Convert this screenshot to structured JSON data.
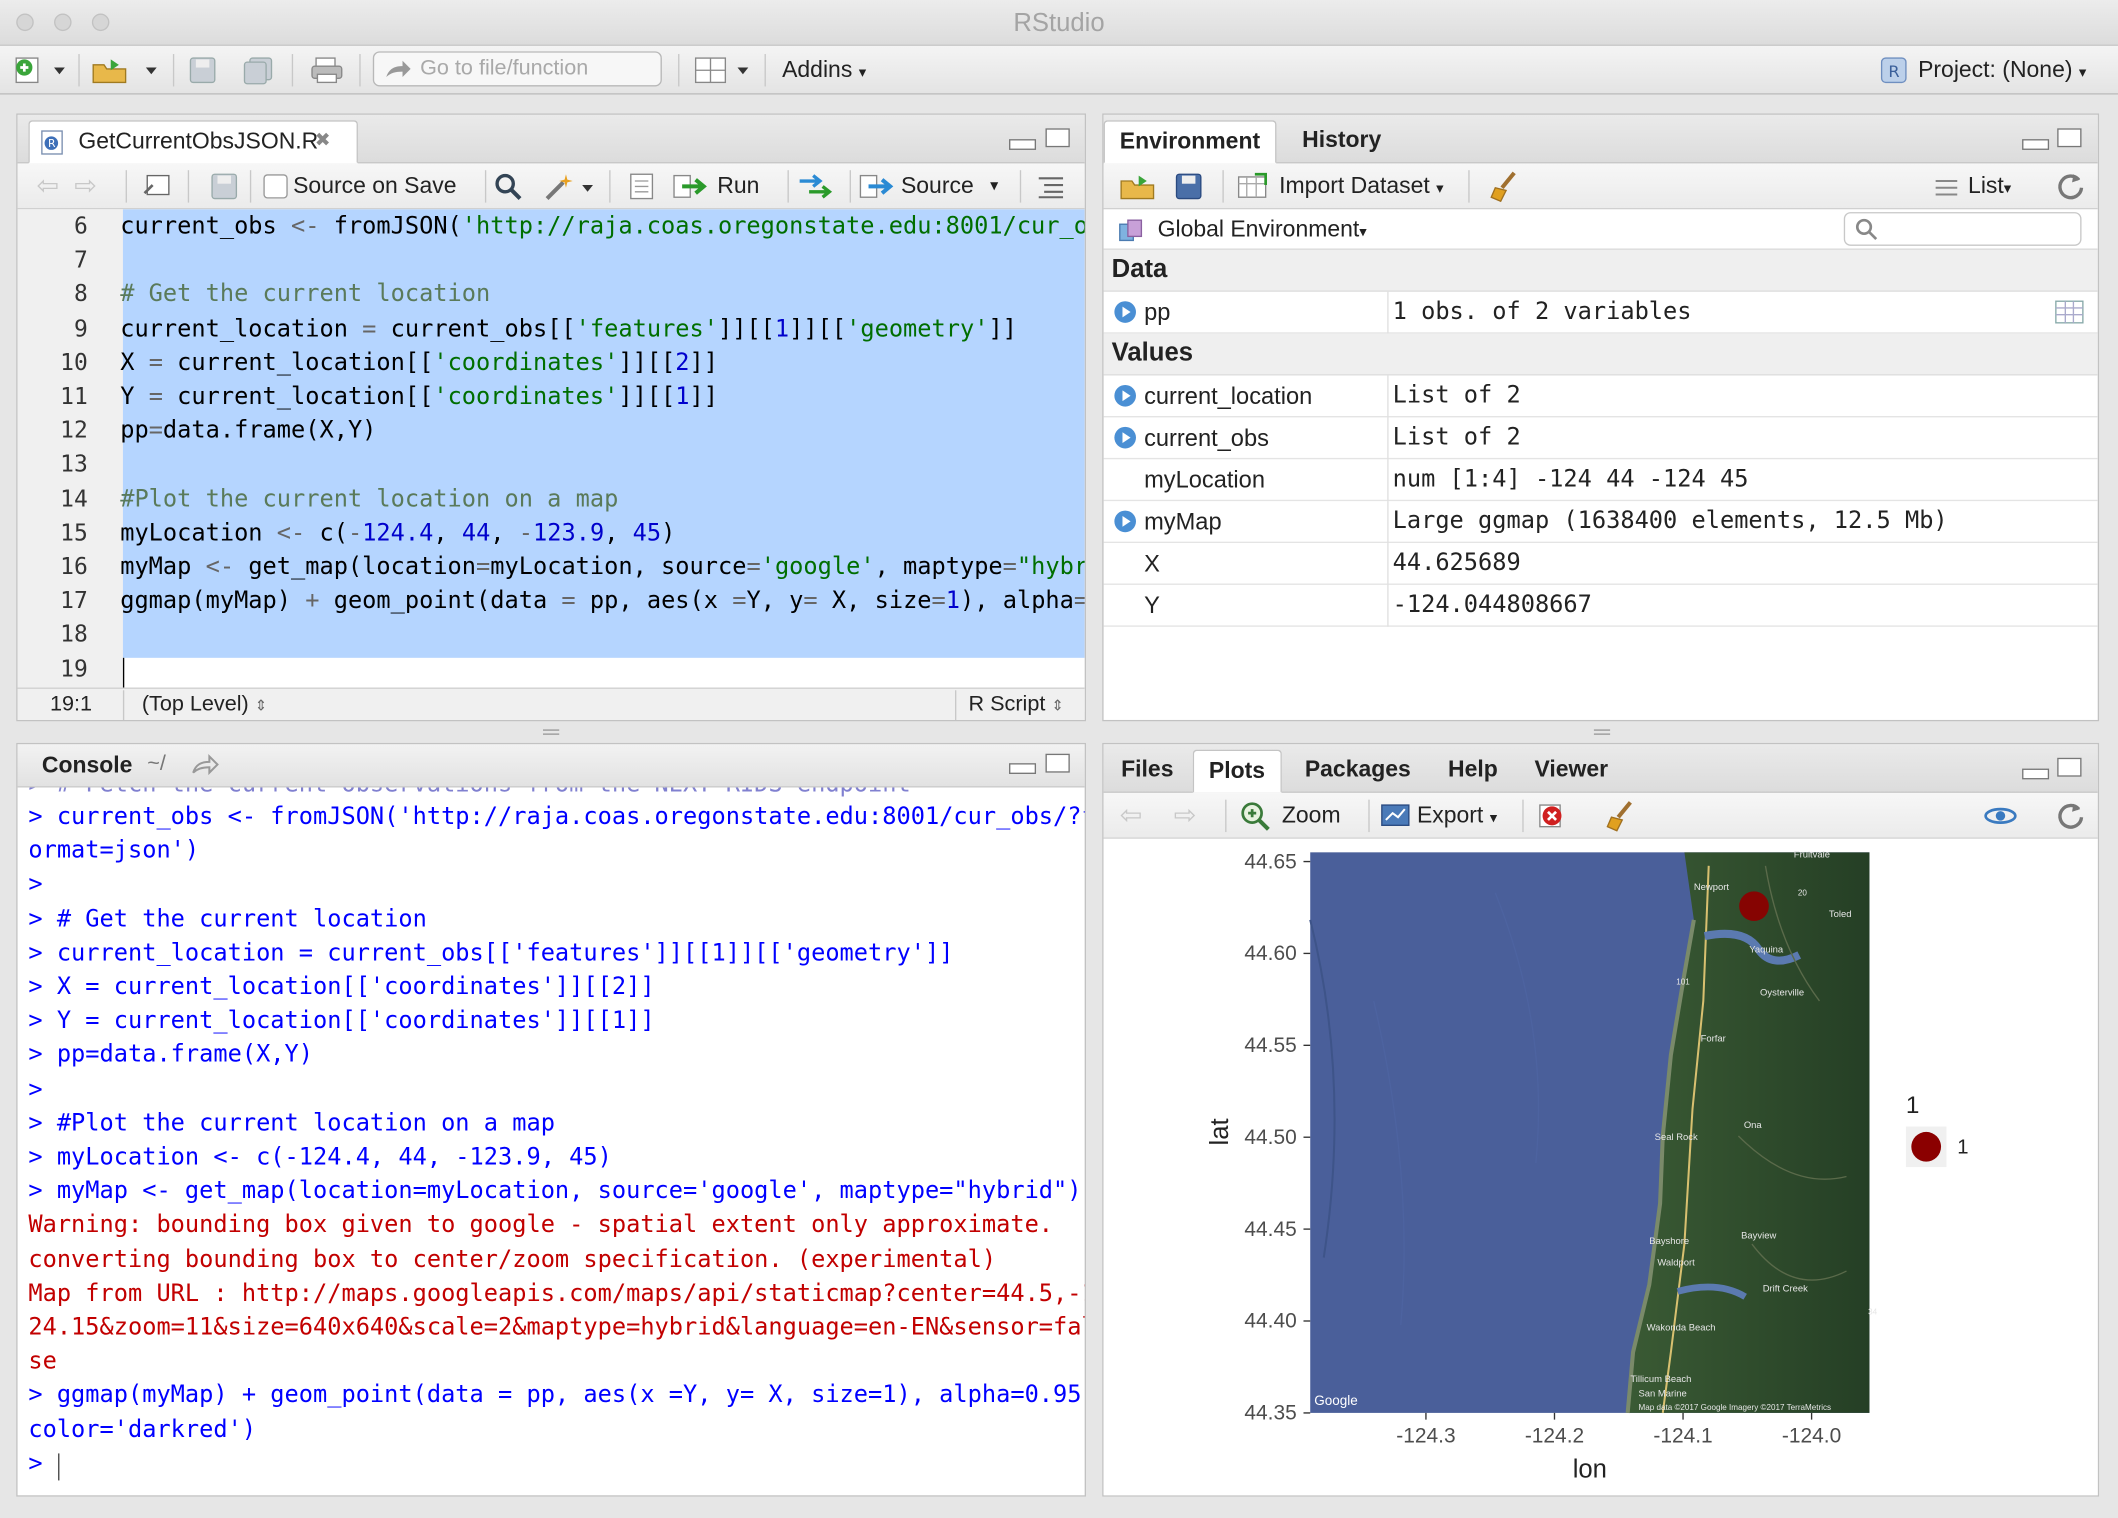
{
  "window": {
    "title": "RStudio"
  },
  "toolbar": {
    "goto_placeholder": "Go to file/function",
    "addins": "Addins",
    "project": "Project: (None)"
  },
  "editor": {
    "tab": "GetCurrentObsJSON.R",
    "source_on_save": "Source on Save",
    "run": "Run",
    "source": "Source",
    "line_numbers": [
      "6",
      "7",
      "8",
      "9",
      "10",
      "11",
      "12",
      "13",
      "14",
      "15",
      "16",
      "17",
      "18",
      "19"
    ],
    "lines": [
      "current_obs <- fromJSON('http://raja.coas.oregonstate.edu:8001/cur_ob",
      "",
      "# Get the current location",
      "current_location = current_obs[['features']][[1]][['geometry']]",
      "X = current_location[['coordinates']][[2]]",
      "Y = current_location[['coordinates']][[1]]",
      "pp=data.frame(X,Y)",
      "",
      "#Plot the current location on a map",
      "myLocation <- c(-124.4, 44, -123.9, 45)",
      "myMap <- get_map(location=myLocation, source='google', maptype=\"hybri",
      "ggmap(myMap) + geom_point(data = pp, aes(x =Y, y= X, size=1), alpha=0",
      "",
      ""
    ],
    "status_pos": "19:1",
    "status_scope": "(Top Level)",
    "status_type": "R Script"
  },
  "environment": {
    "tabs": [
      "Environment",
      "History"
    ],
    "import_dataset": "Import Dataset",
    "list_view": "List",
    "scope": "Global Environment",
    "data_header": "Data",
    "values_header": "Values",
    "data": [
      {
        "name": "pp",
        "value": "1 obs. of 2 variables"
      }
    ],
    "values": [
      {
        "name": "current_location",
        "value": "List of 2"
      },
      {
        "name": "current_obs",
        "value": "List of 2"
      },
      {
        "name": "myLocation",
        "value": "num [1:4] -124 44 -124 45"
      },
      {
        "name": "myMap",
        "value": "Large ggmap (1638400 elements, 12.5 Mb)"
      },
      {
        "name": "X",
        "value": "44.625689"
      },
      {
        "name": "Y",
        "value": "-124.044808667"
      }
    ]
  },
  "console": {
    "title": "Console",
    "path": "~/",
    "lines": [
      {
        "t": "> current_obs <- fromJSON('http://raja.coas.oregonstate.edu:8001/cur_obs/?f",
        "k": "in"
      },
      {
        "t": "ormat=json')",
        "k": "in"
      },
      {
        "t": ">",
        "k": "in"
      },
      {
        "t": "> # Get the current location",
        "k": "in"
      },
      {
        "t": "> current_location = current_obs[['features']][[1]][['geometry']]",
        "k": "in"
      },
      {
        "t": "> X = current_location[['coordinates']][[2]]",
        "k": "in"
      },
      {
        "t": "> Y = current_location[['coordinates']][[1]]",
        "k": "in"
      },
      {
        "t": "> pp=data.frame(X,Y)",
        "k": "in"
      },
      {
        "t": ">",
        "k": "in"
      },
      {
        "t": "> #Plot the current location on a map",
        "k": "in"
      },
      {
        "t": "> myLocation <- c(-124.4, 44, -123.9, 45)",
        "k": "in"
      },
      {
        "t": "> myMap <- get_map(location=myLocation, source='google', maptype=\"hybrid\")",
        "k": "in"
      },
      {
        "t": "Warning: bounding box given to google - spatial extent only approximate.",
        "k": "err"
      },
      {
        "t": "converting bounding box to center/zoom specification. (experimental)",
        "k": "err"
      },
      {
        "t": "Map from URL : http://maps.googleapis.com/maps/api/staticmap?center=44.5,-1",
        "k": "err"
      },
      {
        "t": "24.15&zoom=11&size=640x640&scale=2&maptype=hybrid&language=en-EN&sensor=fal",
        "k": "err"
      },
      {
        "t": "se",
        "k": "err"
      },
      {
        "t": "> ggmap(myMap) + geom_point(data = pp, aes(x =Y, y= X, size=1), alpha=0.95,",
        "k": "in"
      },
      {
        "t": "color='darkred')",
        "k": "in"
      },
      {
        "t": "> ",
        "k": "in"
      }
    ]
  },
  "files_pane": {
    "tabs": [
      "Files",
      "Plots",
      "Packages",
      "Help",
      "Viewer"
    ],
    "zoom": "Zoom",
    "export": "Export"
  },
  "chart_data": {
    "type": "scatter",
    "title": "",
    "xlabel": "lon",
    "ylabel": "lat",
    "xlim": [
      -124.39,
      -123.955
    ],
    "ylim": [
      44.35,
      44.655
    ],
    "x_ticks": [
      -124.3,
      -124.2,
      -124.1,
      -124.0
    ],
    "x_tick_labels": [
      "-124.3",
      "-124.2",
      "-124.1",
      "-124.0"
    ],
    "y_ticks": [
      44.35,
      44.4,
      44.45,
      44.5,
      44.55,
      44.6,
      44.65
    ],
    "y_tick_labels": [
      "44.35",
      "44.40",
      "44.45",
      "44.50",
      "44.55",
      "44.60",
      "44.65"
    ],
    "points": [
      {
        "x": -124.044808667,
        "y": 44.625689,
        "color": "#8b0000"
      }
    ],
    "legend": {
      "title": "1",
      "entries": [
        "1"
      ],
      "placement": "right"
    },
    "basemap_labels": [
      "Fruitvale",
      "Newport",
      "Yaquina",
      "Toled",
      "Oysterville",
      "Forfar",
      "Ona",
      "Seal Rock",
      "Bayview",
      "Bayshore",
      "Waldport",
      "Drift Creek",
      "Wakonda Beach",
      "Tillicum Beach",
      "San Marine",
      "Google",
      "Map data ©2017 Google Imagery ©2017 TerraMetrics",
      "101",
      "20",
      "34"
    ],
    "colors": {
      "ocean": "#4a5f9a",
      "land": "#2d4a2c",
      "point": "#8b0000"
    }
  }
}
